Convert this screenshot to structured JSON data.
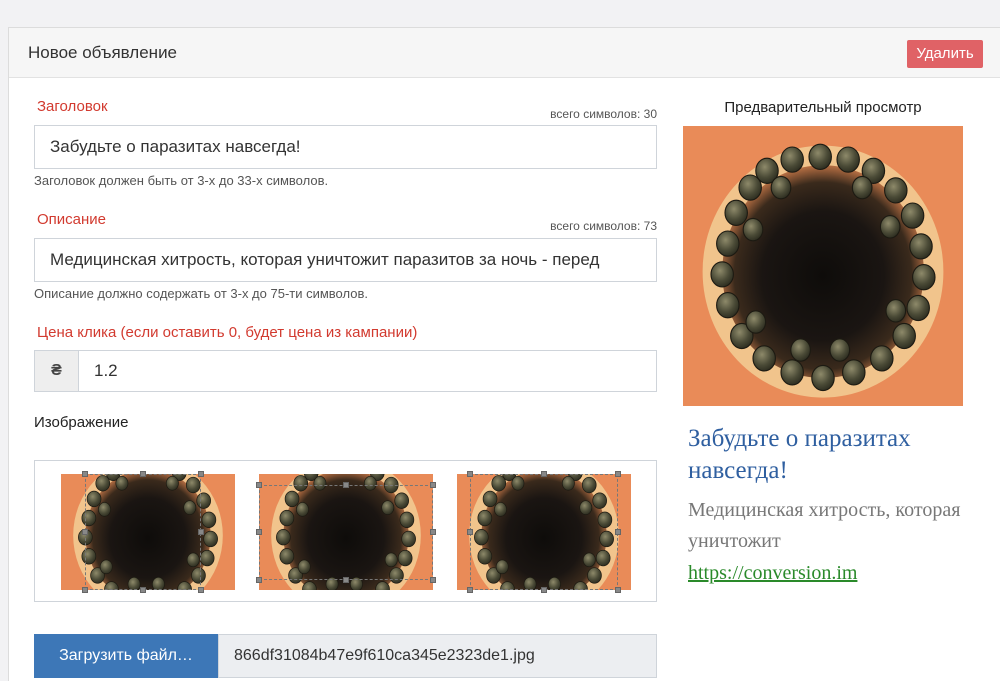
{
  "header": {
    "title": "Новое объявление",
    "delete_label": "Удалить"
  },
  "form": {
    "title_field": {
      "label": "Заголовок",
      "counter": "всего символов: 30",
      "value": "Забудьте о паразитах навсегда!",
      "help": "Заголовок должен быть от 3-х до 33-х символов."
    },
    "description_field": {
      "label": "Описание",
      "counter": "всего символов: 73",
      "value": "Медицинская хитрость, которая уничтожит паразитов за ночь - перед",
      "help": "Описание должно содержать от 3-х до 75-ти символов."
    },
    "price_field": {
      "label": "Цена клика (если оставить 0, будет цена из кампании)",
      "currency": "₴",
      "value": "1.2"
    },
    "image_section": {
      "label": "Изображение"
    },
    "upload": {
      "button_label": "Загрузить файл…",
      "file_name": "866df31084b47e9f610ca345e2323de1.jpg"
    }
  },
  "preview": {
    "heading": "Предварительный просмотр",
    "ad_title": "Забудьте о паразитах навсегда!",
    "ad_description": "Медицинская хитрость, которая уничтожит",
    "ad_link": "https://conversion.im"
  },
  "colors": {
    "accent": "#3d77b7",
    "danger": "#e06266",
    "label_red": "#d23a2f",
    "link_green": "#2a8a2a",
    "ad_title_blue": "#2f5fa0"
  }
}
